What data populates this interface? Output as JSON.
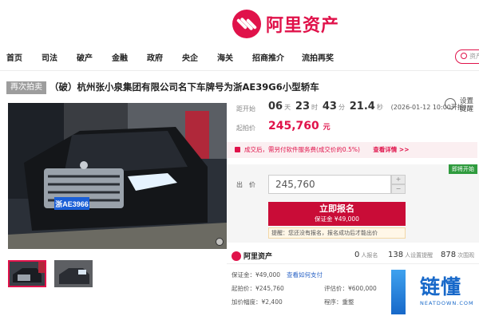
{
  "brand": {
    "name": "阿里资产"
  },
  "nav": {
    "items": [
      "首页",
      "司法",
      "破产",
      "金融",
      "政府",
      "央企",
      "海关",
      "招商推介",
      "流拍再奖"
    ],
    "search_placeholder": "资产"
  },
  "item": {
    "tag": "再次拍卖",
    "title": "（破）杭州张小泉集团有限公司名下车牌号为浙AE39G6小型轿车",
    "plate": "浙AE3966"
  },
  "auction": {
    "countdown_label": "距开始",
    "days": "06",
    "days_unit": "天",
    "hours": "23",
    "hours_unit": "时",
    "minutes": "43",
    "minutes_unit": "分",
    "seconds": "21.4",
    "seconds_unit": "秒",
    "start_time": "(2026-01-12 10:00开拍)",
    "remind_label": "设置提醒",
    "start_price_label": "起拍价",
    "start_price": "245,760",
    "currency_unit": "元",
    "notice": "成交后，需另付软件服务费(成交价的0.5%)",
    "notice_link": "查看详情 >>",
    "status_badge": "即将开始",
    "bid_label": "出　价",
    "bid_value": "245,760",
    "step_up": "+",
    "step_down": "−",
    "apply_label": "立即报名",
    "deposit_line": "保证金 ¥49,000",
    "hint": "提醒：您还没有报名，报名成功后才能出价"
  },
  "stats": {
    "signup_count": "0",
    "signup_label": "人报名",
    "remind_count": "138",
    "remind_label": "人设置提醒",
    "watch_count": "878",
    "watch_label": "次围观"
  },
  "details": {
    "deposit_label": "保证金：¥49,000",
    "deposit_link": "查看如何支付",
    "start_price": "起拍价：¥245,760",
    "increment": "加价幅度：¥2,400",
    "appraisal": "评估价：¥600,000",
    "procedure": "程序：重整"
  },
  "watermark": {
    "title": "链懂",
    "subtitle": "NEATDOWN.COM"
  },
  "colors": {
    "brand": "#e0124a",
    "button": "#c90c37",
    "badge": "#2f9b3e"
  }
}
